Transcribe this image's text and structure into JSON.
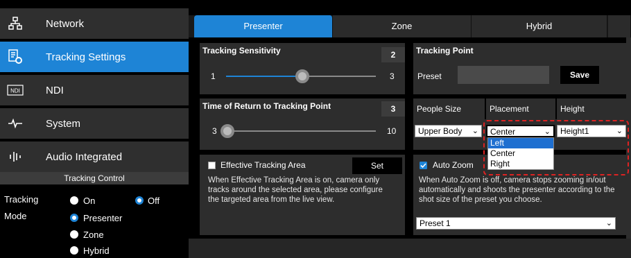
{
  "sidebar": {
    "items": [
      {
        "label": "Network",
        "icon": "network-icon"
      },
      {
        "label": "Tracking Settings",
        "icon": "tracking-settings-icon"
      },
      {
        "label": "NDI",
        "icon": "ndi-icon"
      },
      {
        "label": "System",
        "icon": "system-icon"
      },
      {
        "label": "Audio Integrated",
        "icon": "audio-icon"
      }
    ],
    "tracking_control": {
      "heading": "Tracking Control",
      "tracking_label": "Tracking",
      "mode_label": "Mode",
      "on_label": "On",
      "off_label": "Off",
      "presenter_label": "Presenter",
      "zone_label": "Zone",
      "hybrid_label": "Hybrid"
    }
  },
  "tabs": [
    "Presenter",
    "Zone",
    "Hybrid"
  ],
  "sensitivity": {
    "title": "Tracking Sensitivity",
    "value": "2",
    "min": "1",
    "max": "3"
  },
  "return_time": {
    "title": "Time of Return to Tracking Point",
    "value": "3",
    "min": "3",
    "max": "10"
  },
  "tracking_point": {
    "title": "Tracking Point",
    "preset_label": "Preset",
    "save_label": "Save"
  },
  "people": {
    "size_header": "People Size",
    "placement_header": "Placement",
    "height_header": "Height",
    "size_value": "Upper Body",
    "placement_value": "Center",
    "height_value": "Height1",
    "placement_options": [
      "Left",
      "Center",
      "Right"
    ]
  },
  "effective_area": {
    "label": "Effective Tracking Area",
    "set_label": "Set",
    "desc": [
      "When Effective Tracking Area is on, camera only",
      "tracks around the selected area, please configure",
      "the targeted area from the live view."
    ]
  },
  "auto_zoom": {
    "label": "Auto Zoom",
    "desc": [
      "When Auto Zoom is off, camera stops zooming in/out",
      "automatically and shoots the presenter according to the",
      "shot size of the preset you choose."
    ],
    "preset_value": "Preset 1"
  },
  "colors": {
    "accent": "#1e84d6",
    "panel": "#2d2d2d",
    "highlight": "#1e6fd0"
  }
}
